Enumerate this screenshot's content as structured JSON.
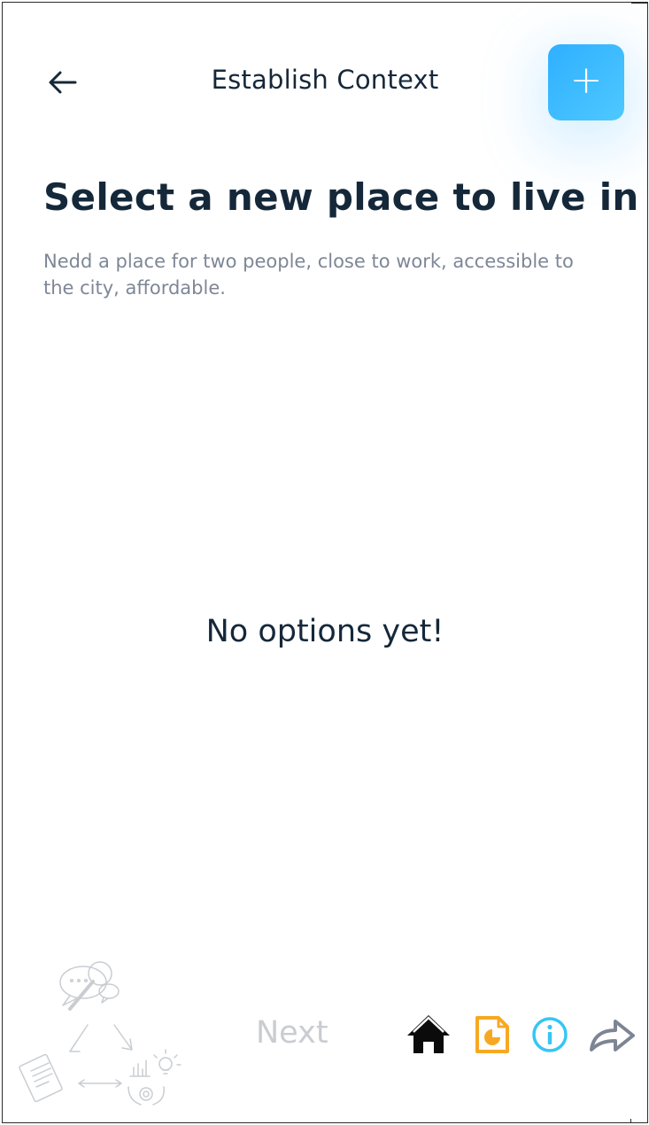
{
  "header": {
    "title": "Establish Context",
    "back_icon": "arrow-left-icon",
    "add_icon": "plus-icon",
    "add_label": "+"
  },
  "main": {
    "title": "Select a new place to live in",
    "description": "Nedd a place for two people, close to work, accessible to the city, affordable.",
    "empty_message": "No options yet!"
  },
  "footer": {
    "next_label": "Next",
    "icons": [
      "home-icon",
      "report-icon",
      "info-icon",
      "share-icon"
    ]
  },
  "colors": {
    "accent": "#38bdf8",
    "title_text": "#15283a",
    "muted_text": "#7e8796",
    "disabled_text": "#c9ccd1",
    "report_orange": "#f7a823",
    "info_blue": "#34c6f4",
    "share_gray": "#7d8594"
  }
}
